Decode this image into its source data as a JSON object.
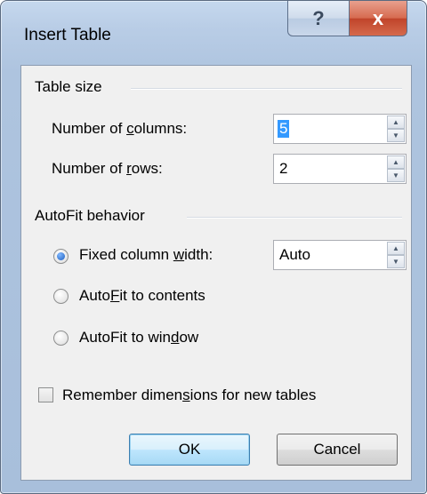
{
  "window": {
    "title": "Insert Table",
    "help_glyph": "?",
    "close_glyph": "x"
  },
  "table_size": {
    "group_label": "Table size",
    "columns": {
      "label_pre": "Number of ",
      "label_u": "c",
      "label_post": "olumns:",
      "value": "5"
    },
    "rows": {
      "label_pre": "Number of ",
      "label_u": "r",
      "label_post": "ows:",
      "value": "2"
    }
  },
  "autofit": {
    "group_label": "AutoFit behavior",
    "fixed": {
      "label_pre": "Fixed column ",
      "label_u": "w",
      "label_post": "idth:",
      "value": "Auto",
      "checked": true
    },
    "contents": {
      "label_pre": "Auto",
      "label_u": "F",
      "label_post": "it to contents",
      "checked": false
    },
    "window": {
      "label_pre": "AutoFit to win",
      "label_u": "d",
      "label_post": "ow",
      "checked": false
    }
  },
  "remember": {
    "label_pre": "Remember dimen",
    "label_u": "s",
    "label_post": "ions for new tables",
    "checked": false
  },
  "buttons": {
    "ok": "OK",
    "cancel": "Cancel"
  }
}
